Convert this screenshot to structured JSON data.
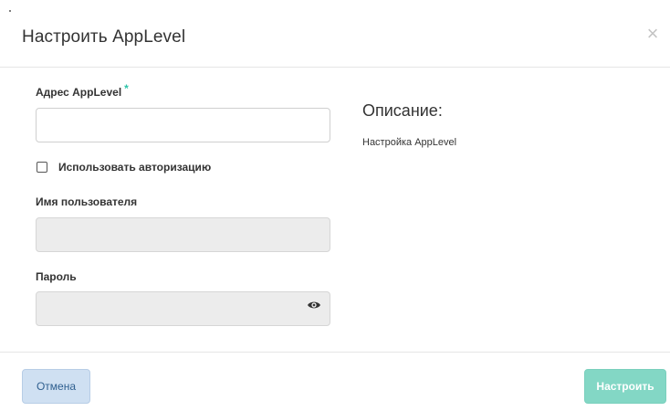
{
  "dialog": {
    "title": "Настроить AppLevel",
    "close_symbol": "×"
  },
  "form": {
    "address": {
      "label": "Адрес AppLevel",
      "required_mark": "*",
      "value": "",
      "placeholder": ""
    },
    "use_auth": {
      "label": "Использовать авторизацию",
      "checked": false
    },
    "username": {
      "label": "Имя пользователя",
      "value": "",
      "disabled": true
    },
    "password": {
      "label": "Пароль",
      "value": "",
      "disabled": true,
      "icon": "eye-icon"
    }
  },
  "description": {
    "title": "Описание:",
    "text": "Настройка AppLevel"
  },
  "footer": {
    "cancel_label": "Отмена",
    "submit_label": "Настроить"
  },
  "colors": {
    "accent": "#2ec4a9",
    "submit_bg": "#83d7c5",
    "cancel_bg": "#cfe0f2",
    "disabled_input_bg": "#ececec"
  }
}
